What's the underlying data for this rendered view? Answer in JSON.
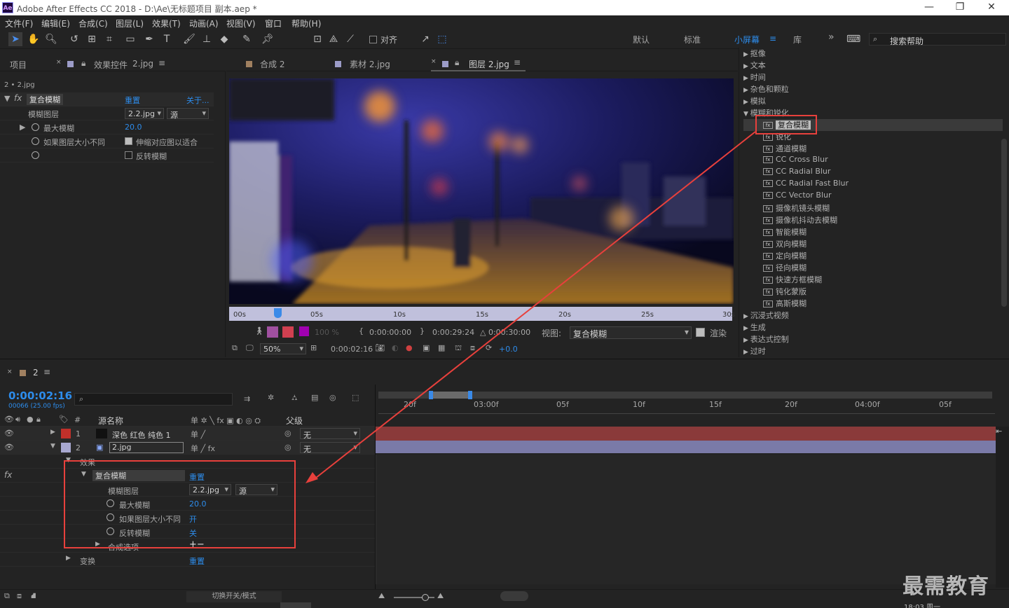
{
  "window": {
    "app_badge": "Ae",
    "title": "Adobe After Effects CC 2018 - D:\\Ae\\无标题项目 副本.aep *",
    "minimize": "—",
    "restore": "❐",
    "close": "✕"
  },
  "menu": [
    "文件(F)",
    "编辑(E)",
    "合成(C)",
    "图层(L)",
    "效果(T)",
    "动画(A)",
    "视图(V)",
    "窗口",
    "帮助(H)"
  ],
  "toolbar": {
    "align_label": "对齐",
    "workspaces": [
      "默认",
      "标准",
      "小屏幕",
      "库"
    ],
    "active_workspace": "小屏幕",
    "overflow": "»",
    "search_placeholder": "搜索帮助"
  },
  "left_panel": {
    "tab_project": "项目",
    "tab_effect_controls": "效果控件",
    "tab_effect_controls_target": "2.jpg",
    "breadcrumb": "2 • 2.jpg",
    "effect_name": "复合模糊",
    "reset": "重置",
    "about": "关于...",
    "params": [
      {
        "label": "模糊图层",
        "layer": "2.2.jpg",
        "source": "源"
      },
      {
        "label": "最大模糊",
        "value": "20.0"
      },
      {
        "label": "如果图层大小不同",
        "option": "伸缩对应图以适合"
      },
      {
        "label": "",
        "option": "反转模糊"
      }
    ]
  },
  "center_panel": {
    "tabs": [
      {
        "label": "合成 2",
        "color": "#a08060"
      },
      {
        "label": "素材 2.jpg",
        "color": "#9c9cc8"
      },
      {
        "label": "图层 2.jpg",
        "color": "#9c9cc8",
        "active": true
      }
    ],
    "ruler_ticks": [
      "00s",
      "05s",
      "10s",
      "15s",
      "20s",
      "25s",
      "30s"
    ],
    "in_time": "0:00:00:00",
    "out_time": "0:00:29:24",
    "duration": "△ 0:00:30:00",
    "view_label": "视图:",
    "view_value": "复合模糊",
    "render_label": "渲染",
    "opacity": "100 %",
    "zoom": "50%",
    "current_time": "0:00:02:16",
    "exposure": "+0.0"
  },
  "effects_panel": {
    "items": [
      {
        "label": "抠像",
        "type": "category"
      },
      {
        "label": "文本",
        "type": "category"
      },
      {
        "label": "时间",
        "type": "category"
      },
      {
        "label": "杂色和颗粒",
        "type": "category"
      },
      {
        "label": "模拟",
        "type": "category"
      },
      {
        "label": "模糊和锐化",
        "type": "category-open"
      },
      {
        "label": "复合模糊",
        "type": "effect",
        "selected": true
      },
      {
        "label": "锐化",
        "type": "effect"
      },
      {
        "label": "通道模糊",
        "type": "effect"
      },
      {
        "label": "CC Cross Blur",
        "type": "effect"
      },
      {
        "label": "CC Radial Blur",
        "type": "effect"
      },
      {
        "label": "CC Radial Fast Blur",
        "type": "effect"
      },
      {
        "label": "CC Vector Blur",
        "type": "effect"
      },
      {
        "label": "摄像机镜头模糊",
        "type": "effect"
      },
      {
        "label": "摄像机抖动去模糊",
        "type": "effect"
      },
      {
        "label": "智能模糊",
        "type": "effect"
      },
      {
        "label": "双向模糊",
        "type": "effect"
      },
      {
        "label": "定向模糊",
        "type": "effect"
      },
      {
        "label": "径向模糊",
        "type": "effect"
      },
      {
        "label": "快速方框模糊",
        "type": "effect"
      },
      {
        "label": "钝化蒙版",
        "type": "effect"
      },
      {
        "label": "高斯模糊",
        "type": "effect"
      },
      {
        "label": "沉浸式视频",
        "type": "category"
      },
      {
        "label": "生成",
        "type": "category"
      },
      {
        "label": "表达式控制",
        "type": "category"
      },
      {
        "label": "过时",
        "type": "category"
      }
    ]
  },
  "timeline": {
    "comp_name": "2",
    "timecode": "0:00:02:16",
    "frames": "00066 (25.00 fps)",
    "col_source": "源名称",
    "col_parent": "父级",
    "col_hash": "#",
    "ruler": [
      "20f",
      "03:00f",
      "05f",
      "10f",
      "15f",
      "20f",
      "04:00f",
      "05f"
    ],
    "layers": [
      {
        "num": "1",
        "name": "深色 红色 纯色 1",
        "color": "#c0302a",
        "parent": "无"
      },
      {
        "num": "2",
        "name": "2.jpg",
        "color": "#a8a8d0",
        "parent": "无"
      }
    ],
    "effects_group": "效果",
    "effect_name": "复合模糊",
    "reset": "重置",
    "params": [
      {
        "label": "模糊图层",
        "layer": "2.2.jpg",
        "source": "源"
      },
      {
        "label": "最大模糊",
        "value": "20.0"
      },
      {
        "label": "如果图层大小不同",
        "value": "开"
      },
      {
        "label": "反转模糊",
        "value": "关"
      },
      {
        "label": "合成选项",
        "value": "+−"
      }
    ],
    "transform": "变换",
    "transform_reset": "重置",
    "toggle_label": "切换开关/模式",
    "partial_time": "18:03 周一"
  },
  "watermark": "最需教育"
}
